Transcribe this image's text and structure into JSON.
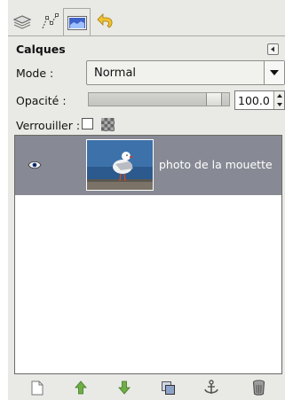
{
  "panel": {
    "tabs": [
      {
        "icon": "layers-tab-icon"
      },
      {
        "icon": "channels-tab-icon"
      },
      {
        "icon": "paths-tab-icon"
      },
      {
        "icon": "undo-history-tab-icon"
      }
    ],
    "title": "Calques"
  },
  "mode": {
    "label": "Mode :",
    "value": "Normal"
  },
  "opacity": {
    "label": "Opacité :",
    "value": "100.0",
    "level": 1.0
  },
  "lock": {
    "label": "Verrouiller :",
    "pixels_locked": false
  },
  "layers": [
    {
      "name": "photo de la mouette",
      "visible": true,
      "selected": true
    }
  ],
  "toolbar": {
    "buttons": [
      {
        "icon": "new-layer-icon"
      },
      {
        "icon": "raise-layer-icon"
      },
      {
        "icon": "lower-layer-icon"
      },
      {
        "icon": "duplicate-layer-icon"
      },
      {
        "icon": "anchor-layer-icon"
      },
      {
        "icon": "delete-layer-icon"
      }
    ]
  },
  "colors": {
    "selected_row": "#878a94",
    "panel_bg": "#e9e9e5",
    "arrow_green": "#6fae46"
  }
}
